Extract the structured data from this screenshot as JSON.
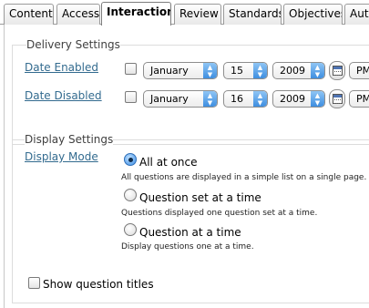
{
  "tabs": [
    {
      "label": "Content"
    },
    {
      "label": "Access"
    },
    {
      "label": "Interaction"
    },
    {
      "label": "Review"
    },
    {
      "label": "Standards"
    },
    {
      "label": "Objectives"
    },
    {
      "label": "Aut"
    }
  ],
  "active_tab": "Interaction",
  "delivery": {
    "legend": "Delivery Settings",
    "date_enabled": {
      "label": "Date Enabled",
      "checked": false,
      "month": "January",
      "day": "15",
      "year": "2009",
      "ampm": "PM"
    },
    "date_disabled": {
      "label": "Date Disabled",
      "checked": false,
      "month": "January",
      "day": "16",
      "year": "2009",
      "ampm": "PM"
    }
  },
  "display": {
    "legend": "Display Settings",
    "mode_label": "Display Mode",
    "options": [
      {
        "label": "All at once",
        "description": "All questions are displayed in a simple list on a single page.",
        "selected": true
      },
      {
        "label": "Question set at a time",
        "description": "Questions displayed one question set at a time.",
        "selected": false
      },
      {
        "label": "Question at a time",
        "description": "Display questions one at a time.",
        "selected": false
      }
    ]
  },
  "show_titles": {
    "label": "Show question titles",
    "checked": false
  },
  "icons": {
    "select_arrows": "up-down-arrows-icon",
    "calendar": "calendar-icon"
  },
  "colors": {
    "link": "#336b8f",
    "select_accent": "#3e8ee0"
  }
}
